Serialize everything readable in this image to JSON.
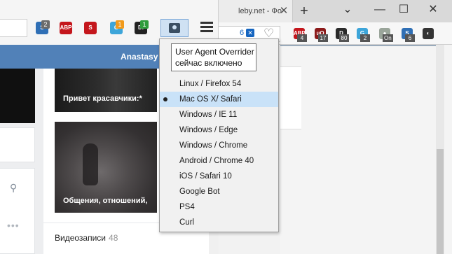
{
  "back_window": {
    "tab_title": "leby.net - Фо",
    "tab_close": "✕",
    "new_tab": "+",
    "controls": {
      "dropdown": "⌄",
      "minimize": "—",
      "maximize": "☐",
      "close": "✕"
    },
    "tab_count": "6",
    "extensions": [
      {
        "name": "abp",
        "label": "ABP",
        "badge": "4",
        "color": "#c4161c"
      },
      {
        "name": "ublock",
        "label": "uO",
        "badge": "17",
        "color": "#8b1a1a"
      },
      {
        "name": "disconnect",
        "label": "D",
        "badge": "80",
        "color": "#2a2a2a"
      },
      {
        "name": "ghostery",
        "label": "G",
        "badge": "2",
        "color": "#3da5d9"
      },
      {
        "name": "on-toggle",
        "label": "●",
        "badge": "On",
        "color": "#9aa59a"
      },
      {
        "name": "s-badge",
        "label": "S",
        "badge": "6",
        "color": "#2f6fb5"
      },
      {
        "name": "privacy-shield",
        "label": "◐",
        "badge": "",
        "color": "#333333"
      }
    ]
  },
  "front_window": {
    "extensions": [
      {
        "name": "s-ext",
        "label": "S",
        "badge": "2",
        "icon_color": "#2f6fb5",
        "badge_color": "#6b6b6b"
      },
      {
        "name": "adblock-plus",
        "label": "ABP",
        "badge": "",
        "icon_color": "#c4161c",
        "badge_color": ""
      },
      {
        "name": "block-ext",
        "label": "S",
        "badge": "",
        "icon_color": "#c4161c",
        "badge_color": ""
      },
      {
        "name": "ghostery",
        "label": "G",
        "badge": "1",
        "icon_color": "#3da5d9",
        "badge_color": "#f19a1b"
      },
      {
        "name": "disconnect",
        "label": "D.",
        "badge": "1",
        "icon_color": "#222222",
        "badge_color": "#2e9c3c"
      }
    ],
    "header_user": "Anastasy",
    "photo1_caption": "Привет красавчики:*",
    "photo2_caption": "Общения, отношений,",
    "videos": {
      "label": "Видеозаписи",
      "count": "48"
    }
  },
  "ua_switcher": {
    "tooltip_line1": "User Agent Overrider",
    "tooltip_line2": "сейчас включено",
    "selected": "Mac OS X/ Safari",
    "items": [
      "Linux / Firefox 54",
      "Mac OS X/ Safari",
      "Windows / IE 11",
      "Windows / Edge",
      "Windows / Chrome",
      "Android / Chrome 40",
      "iOS / Safari 10",
      "Google Bot",
      "PS4",
      "Curl"
    ]
  }
}
